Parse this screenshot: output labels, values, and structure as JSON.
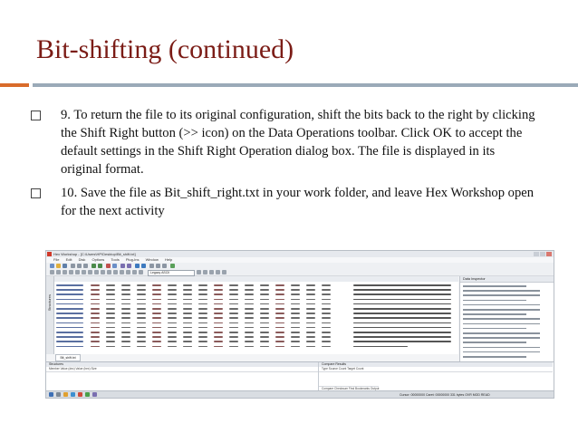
{
  "slide": {
    "title": "Bit-shifting (continued)",
    "bullets": [
      "9. To return the file to its original configuration, shift the bits back to the right by clicking the Shift Right button (>> icon) on the Data Operations toolbar. Click OK to accept the default settings in the Shift Right Operation dialog box. The file is displayed in its original format.",
      " 10. Save the file as Bit_shift_right.txt in your work folder, and leave Hex Workshop open for the next activity"
    ]
  },
  "screenshot": {
    "window_title": "Hex Workshop - [C:\\Users\\HP\\Desktop\\Bit_shift.txt]",
    "menu": [
      "File",
      "Edit",
      "Disk",
      "Options",
      "Tools",
      "Plug-Ins",
      "Window",
      "Help"
    ],
    "encoding_combo": "Legacy ASCII",
    "side_label": "Structures",
    "data_inspector_title": "Data Inspector",
    "document_tab": "Bit_shift.txt",
    "bottom_panels": [
      "Structures",
      "Compare Results"
    ],
    "structures_columns": "Member    Value (dec)    Value (hex)    Size",
    "compare_columns": "Type    Source    Count    Target    Count",
    "bottom_tabs": "Compare  Checksum  Find  Bookmarks  Output",
    "status_text": "Cursor: 00000000   Caret: 00000000   331 bytes   OVR   MOD   READ"
  },
  "colors": {
    "title": "#7b1c16",
    "accent_rule": "#d96b2b",
    "main_rule": "#9aaab8"
  }
}
